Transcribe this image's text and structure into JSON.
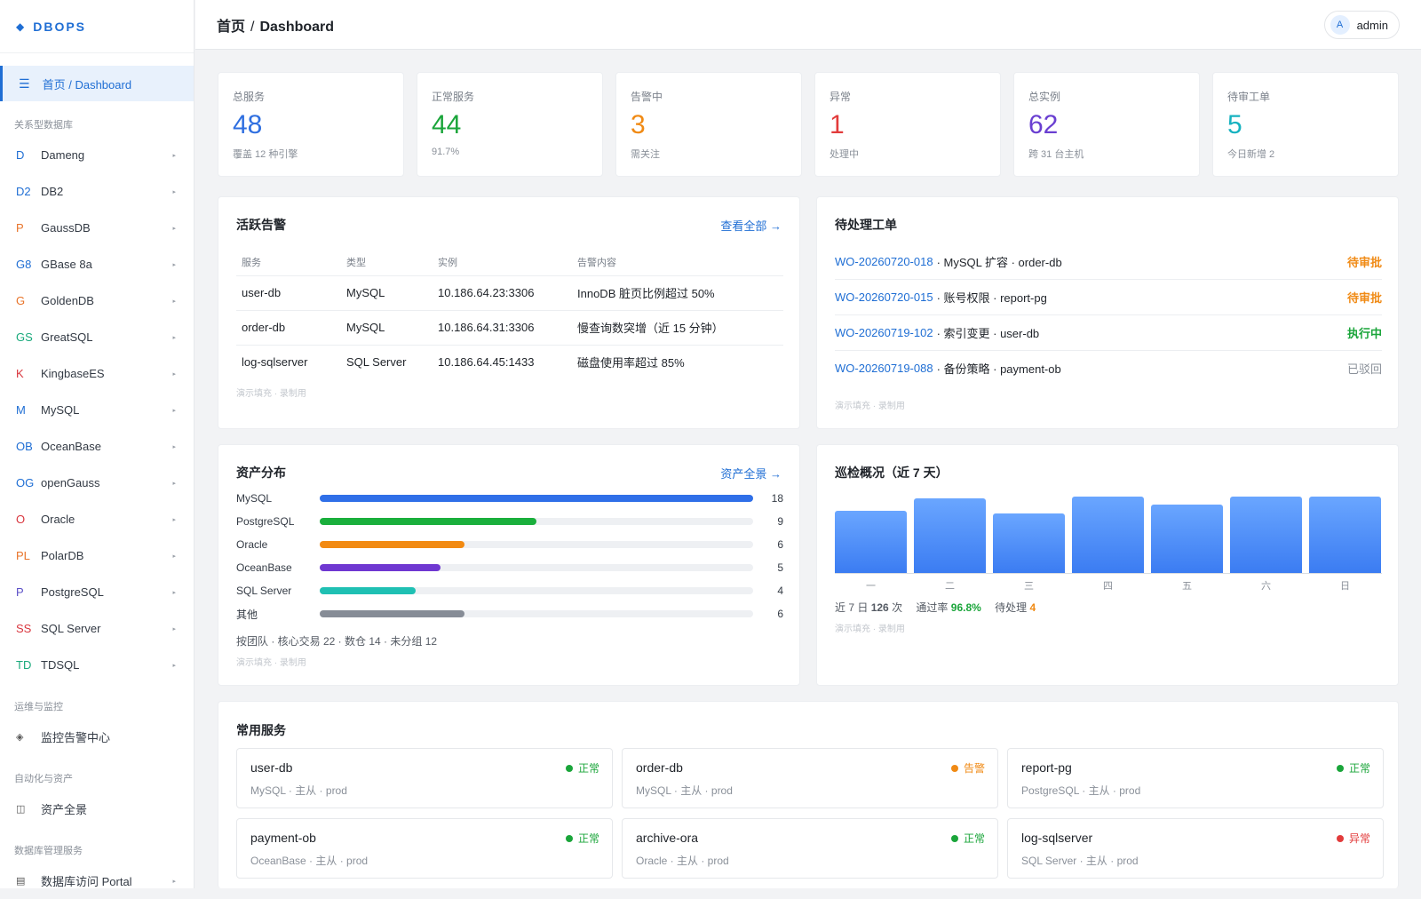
{
  "brand": {
    "icon": "diamond-icon",
    "name": "DBOPS"
  },
  "topbar": {
    "breadcrumb_home": "首页",
    "breadcrumb_sep": "/",
    "breadcrumb_page": "Dashboard",
    "avatar_letter": "A",
    "username": "admin"
  },
  "sidebar": {
    "active": {
      "icon": "menu-icon",
      "home": "首页",
      "sep": "/",
      "page": "Dashboard"
    },
    "group_relational": "关系型数据库",
    "databases": [
      {
        "abbr": "D",
        "name": "Dameng",
        "color": "#1f6ed4"
      },
      {
        "abbr": "D2",
        "name": "DB2",
        "color": "#1f6ed4"
      },
      {
        "abbr": "P",
        "name": "GaussDB",
        "color": "#e8742a"
      },
      {
        "abbr": "G8",
        "name": "GBase 8a",
        "color": "#1f6ed4"
      },
      {
        "abbr": "G",
        "name": "GoldenDB",
        "color": "#e8742a"
      },
      {
        "abbr": "GS",
        "name": "GreatSQL",
        "color": "#19a97b"
      },
      {
        "abbr": "K",
        "name": "KingbaseES",
        "color": "#d9363e"
      },
      {
        "abbr": "M",
        "name": "MySQL",
        "color": "#1f6ed4"
      },
      {
        "abbr": "OB",
        "name": "OceanBase",
        "color": "#1f6ed4"
      },
      {
        "abbr": "OG",
        "name": "openGauss",
        "color": "#1f6ed4"
      },
      {
        "abbr": "O",
        "name": "Oracle",
        "color": "#d9363e"
      },
      {
        "abbr": "PL",
        "name": "PolarDB",
        "color": "#e8742a"
      },
      {
        "abbr": "P",
        "name": "PostgreSQL",
        "color": "#5b4fc7"
      },
      {
        "abbr": "SS",
        "name": "SQL Server",
        "color": "#d9363e"
      },
      {
        "abbr": "TD",
        "name": "TDSQL",
        "color": "#19a97b"
      }
    ],
    "chevron": "▸",
    "group_ops": "运维与监控",
    "monitor": {
      "icon": "diamond-small-icon",
      "label": "监控告警中心"
    },
    "group_auto": "自动化与资产",
    "assets": {
      "icon": "grid-icon",
      "label": "资产全景"
    },
    "group_dbms": "数据库管理服务",
    "portal": {
      "icon": "table-icon",
      "label": "数据库访问 Portal"
    }
  },
  "stats": [
    {
      "label": "总服务",
      "value": "48",
      "sub": "覆盖 12 种引擎",
      "color": "#2f6fe0"
    },
    {
      "label": "正常服务",
      "value": "44",
      "sub": "91.7%",
      "color": "#1aa53a"
    },
    {
      "label": "告警中",
      "value": "3",
      "sub": "需关注",
      "color": "#f08a14"
    },
    {
      "label": "异常",
      "value": "1",
      "sub": "处理中",
      "color": "#e23b3b"
    },
    {
      "label": "总实例",
      "value": "62",
      "sub": "跨 31 台主机",
      "color": "#6a3fd1"
    },
    {
      "label": "待审工单",
      "value": "5",
      "sub": "今日新增 2",
      "color": "#17b2c0"
    }
  ],
  "alerts": {
    "title": "活跃告警",
    "link": "查看全部 →",
    "headers": [
      "服务",
      "类型",
      "实例",
      "告警内容"
    ],
    "rows": [
      [
        "user-db",
        "MySQL",
        "10.186.64.23:3306",
        "InnoDB 脏页比例超过 50%"
      ],
      [
        "order-db",
        "MySQL",
        "10.186.64.31:3306",
        "慢查询数突增（近 15 分钟）"
      ],
      [
        "log-sqlserver",
        "SQL Server",
        "10.186.64.45:1433",
        "磁盘使用率超过 85%"
      ]
    ],
    "demo": "演示填充 · 录制用"
  },
  "orders": {
    "title": "待处理工单",
    "items": [
      {
        "id": "WO-20260720-018",
        "desc": "· MySQL 扩容 · order-db",
        "status": "待审批",
        "color": "#f08a14"
      },
      {
        "id": "WO-20260720-015",
        "desc": "· 账号权限 · report-pg",
        "status": "待审批",
        "color": "#f08a14"
      },
      {
        "id": "WO-20260719-102",
        "desc": "· 索引变更 · user-db",
        "status": "执行中",
        "color": "#1aa53a"
      },
      {
        "id": "WO-20260719-088",
        "desc": "· 备份策略 · payment-ob",
        "status": "已驳回",
        "color": "#8a9099"
      }
    ],
    "demo": "演示填充 · 录制用"
  },
  "assets": {
    "title": "资产分布",
    "link": "资产全景 →",
    "items": [
      {
        "name": "MySQL",
        "value": 18,
        "color": "#2f6fe8"
      },
      {
        "name": "PostgreSQL",
        "value": 9,
        "color": "#1aaf3c"
      },
      {
        "name": "Oracle",
        "value": 6,
        "color": "#f28a12"
      },
      {
        "name": "OceanBase",
        "value": 5,
        "color": "#6f38d1"
      },
      {
        "name": "SQL Server",
        "value": 4,
        "color": "#1fc0b3"
      },
      {
        "name": "其他",
        "value": 6,
        "color": "#868c96"
      }
    ],
    "max": 18,
    "footer": "按团队 · 核心交易 22 · 数仓 14 · 未分组 12",
    "demo": "演示填充 · 录制用"
  },
  "inspection": {
    "title": "巡检概况（近 7 天）",
    "days": [
      "一",
      "二",
      "三",
      "四",
      "五",
      "六",
      "日"
    ],
    "levels": [
      0.8,
      0.95,
      0.76,
      0.98,
      0.88,
      0.98,
      0.98
    ],
    "summary_prefix": "近 7 日",
    "summary_count": "126",
    "summary_unit": "次",
    "pass_label": "通过率",
    "pass_value": "96.8%",
    "pending_label": "待处理",
    "pending_value": "4",
    "demo": "演示填充 · 录制用"
  },
  "services": {
    "title": "常用服务",
    "items": [
      {
        "name": "user-db",
        "meta": "MySQL · 主从 · prod",
        "status": "正常",
        "color": "#1aa53a"
      },
      {
        "name": "order-db",
        "meta": "MySQL · 主从 · prod",
        "status": "告警",
        "color": "#f08a14"
      },
      {
        "name": "report-pg",
        "meta": "PostgreSQL · 主从 · prod",
        "status": "正常",
        "color": "#1aa53a"
      },
      {
        "name": "payment-ob",
        "meta": "OceanBase · 主从 · prod",
        "status": "正常",
        "color": "#1aa53a"
      },
      {
        "name": "archive-ora",
        "meta": "Oracle · 主从 · prod",
        "status": "正常",
        "color": "#1aa53a"
      },
      {
        "name": "log-sqlserver",
        "meta": "SQL Server · 主从 · prod",
        "status": "异常",
        "color": "#e23b3b"
      }
    ]
  }
}
